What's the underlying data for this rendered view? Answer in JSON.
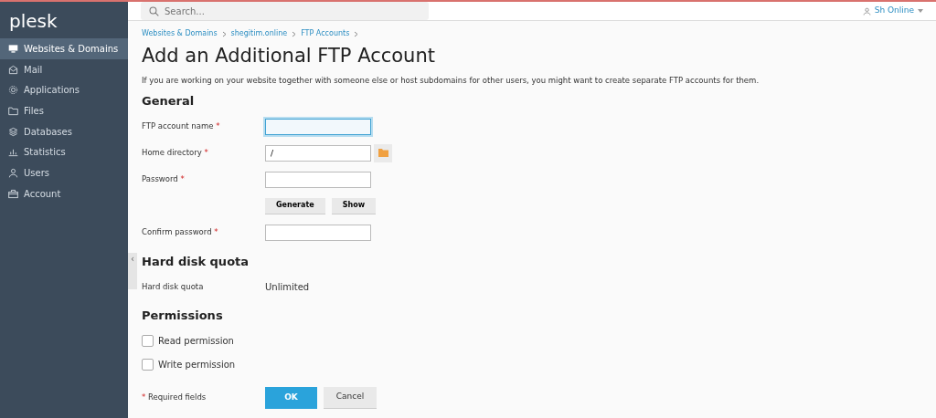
{
  "sidebar": {
    "logo": "plesk",
    "items": [
      {
        "label": "Websites & Domains",
        "selected": true
      },
      {
        "label": "Mail",
        "selected": false
      },
      {
        "label": "Applications",
        "selected": false
      },
      {
        "label": "Files",
        "selected": false
      },
      {
        "label": "Databases",
        "selected": false
      },
      {
        "label": "Statistics",
        "selected": false
      },
      {
        "label": "Users",
        "selected": false
      },
      {
        "label": "Account",
        "selected": false
      }
    ],
    "toggle": "‹"
  },
  "header": {
    "search": {
      "placeholder": "Search..."
    },
    "user": {
      "label": "Sh Online"
    }
  },
  "breadcrumbs": [
    "Websites & Domains",
    "shegitim.online",
    "FTP Accounts"
  ],
  "title": "Add an Additional FTP Account",
  "intro": "If you are working on your website together with someone else or host subdomains for other users, you might want to create separate FTP accounts for them.",
  "sections": [
    {
      "heading": "General",
      "rows": [
        {
          "kind": "input",
          "label": "FTP account name",
          "required_mark": "*",
          "value": "",
          "focused": true
        },
        {
          "kind": "browse",
          "label": "Home directory",
          "required_mark": "*",
          "value": "/",
          "focused": false
        },
        {
          "kind": "input",
          "label": "Password",
          "required_mark": "*",
          "value": "",
          "focused": false
        },
        {
          "kind": "buttons",
          "buttons": [
            "Generate",
            "Show"
          ]
        },
        {
          "kind": "input",
          "label": "Confirm password",
          "required_mark": "*",
          "value": "",
          "focused": false
        }
      ]
    },
    {
      "heading": "Hard disk quota",
      "rows": [
        {
          "kind": "static",
          "label": "Hard disk quota",
          "value": "Unlimited"
        }
      ]
    },
    {
      "heading": "Permissions",
      "rows": [
        {
          "kind": "checkbox",
          "label": "Read permission",
          "checked": false
        },
        {
          "kind": "checkbox",
          "label": "Write permission",
          "checked": false
        }
      ]
    }
  ],
  "footer": {
    "required_mark": "*",
    "required_note": "Required fields",
    "buttons": [
      {
        "label": "OK",
        "kind": "primary"
      },
      {
        "label": "Cancel",
        "kind": "secondary"
      }
    ]
  }
}
